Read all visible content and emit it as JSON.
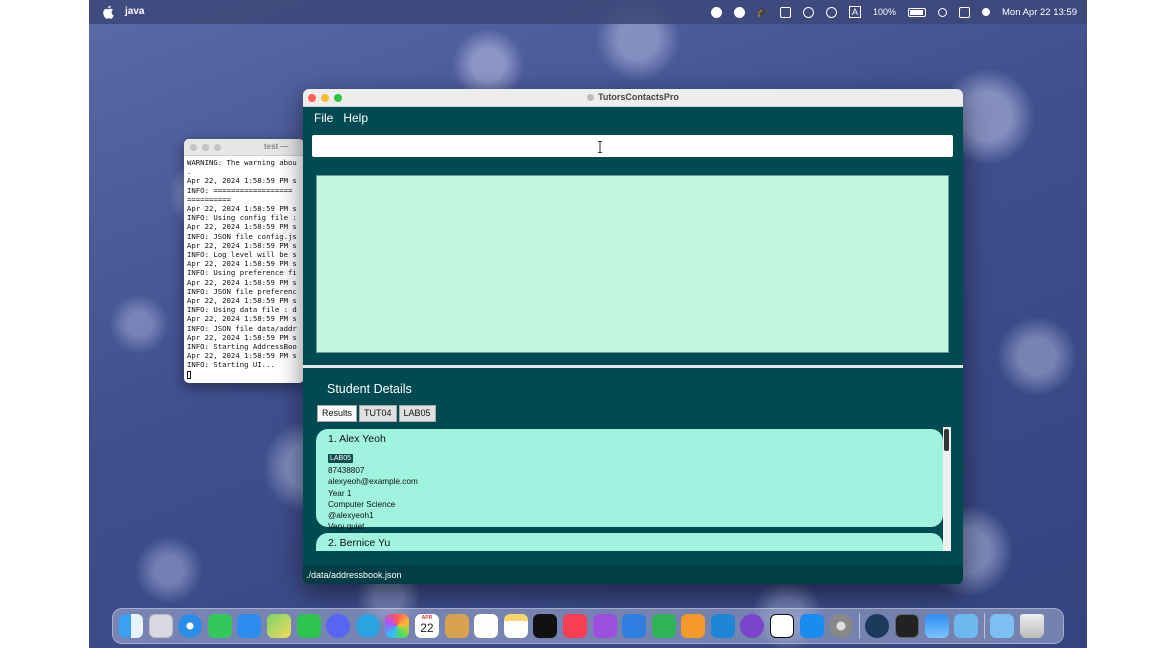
{
  "menubar": {
    "app_name": "java",
    "battery": "100%",
    "datetime": "Mon Apr 22  13:59",
    "input_indicator": "A"
  },
  "terminal": {
    "title": "test —",
    "lines": [
      "WARNING: The warning abou",
      ".",
      "Apr 22, 2024 1:58:59 PM s",
      "INFO: ==================",
      "==========",
      "Apr 22, 2024 1:58:59 PM s",
      "INFO: Using config file :",
      "Apr 22, 2024 1:58:59 PM s",
      "INFO: JSON file config.js",
      "Apr 22, 2024 1:58:59 PM s",
      "INFO: Log level will be s",
      "Apr 22, 2024 1:58:59 PM s",
      "INFO: Using preference fi",
      "Apr 22, 2024 1:58:59 PM s",
      "INFO: JSON file preferenc",
      "Apr 22, 2024 1:58:59 PM s",
      "INFO: Using data file : d",
      "Apr 22, 2024 1:58:59 PM s",
      "INFO: JSON file data/addr",
      "Apr 22, 2024 1:58:59 PM s",
      "INFO: Starting AddressBoo",
      "Apr 22, 2024 1:58:59 PM s",
      "INFO: Starting UI..."
    ]
  },
  "app": {
    "title": "TutorsContactsPro",
    "menu": {
      "file": "File",
      "help": "Help"
    },
    "command_box": {
      "value": "",
      "placeholder": ""
    },
    "details_title": "Student Details",
    "tabs": [
      {
        "label": "Results",
        "active": true
      },
      {
        "label": "TUT04",
        "active": false
      },
      {
        "label": "LAB05",
        "active": false
      }
    ],
    "students": [
      {
        "name": "1.  Alex Yeoh",
        "tags": [
          "LAB05"
        ],
        "phone": "87438807",
        "email": "alexyeoh@example.com",
        "year": "Year 1",
        "major": "Computer Science",
        "telegram": "@alexyeoh1",
        "remark": "Very quiet"
      },
      {
        "name": "2.  Bernice Yu",
        "tags": [
          "",
          ""
        ]
      }
    ],
    "status_bar": "./data/addressbook.json"
  },
  "colors": {
    "app_bg": "#004a52",
    "result_bg": "#c3f5e1",
    "card_bg": "#9ff3df",
    "tag_bg": "#0f4e4e"
  },
  "dock_icons": [
    "finder-icon",
    "launchpad-icon",
    "safari-icon",
    "messages-icon",
    "mail-icon",
    "maps-icon",
    "facetime-icon",
    "discord-icon",
    "telegram-icon",
    "photos-icon",
    "calendar-icon",
    "notes-icon",
    "reminders-icon",
    "stickies-icon",
    "apple-tv-icon",
    "music-icon",
    "podcasts-icon",
    "keynote-icon",
    "numbers-icon",
    "pages-icon",
    "vscode-icon",
    "github-desktop-icon",
    "notion-icon",
    "app-store-icon",
    "system-settings-icon",
    "steam-icon",
    "terminal-icon",
    "weather-icon",
    "folder-icon",
    "downloads-icon",
    "trash-icon"
  ],
  "calendar_icon": {
    "month": "APR",
    "day": "22"
  }
}
